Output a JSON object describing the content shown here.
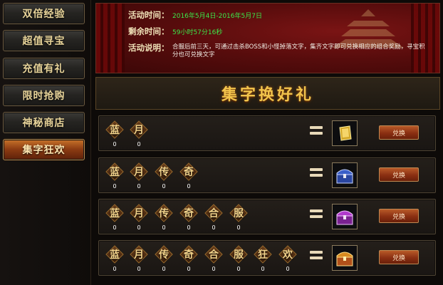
{
  "sidebar": {
    "items": [
      {
        "label": "双倍经验",
        "active": false
      },
      {
        "label": "超值寻宝",
        "active": false
      },
      {
        "label": "充值有礼",
        "active": false
      },
      {
        "label": "限时抢购",
        "active": false
      },
      {
        "label": "神秘商店",
        "active": false
      },
      {
        "label": "集字狂欢",
        "active": true
      }
    ]
  },
  "banner": {
    "time_label": "活动时间：",
    "time_value": "2016年5月4日-2016年5月7日",
    "remaining_label": "剩余时间：",
    "remaining_value": "59小时57分16秒",
    "desc_label": "活动说明：",
    "desc_value": "合服后前三天，可通过击杀BOSS和小怪掉落文字，集齐文字即可兑换相应的组合奖励，寻宝积分也可兑换文字"
  },
  "title": "集字换好礼",
  "rows": [
    {
      "chars": [
        {
          "char": "蓝",
          "count": "0"
        },
        {
          "char": "月",
          "count": "0"
        }
      ],
      "reward_icon": "gold-bar-icon",
      "button": "兑换"
    },
    {
      "chars": [
        {
          "char": "蓝",
          "count": "0"
        },
        {
          "char": "月",
          "count": "0"
        },
        {
          "char": "传",
          "count": "0"
        },
        {
          "char": "奇",
          "count": "0"
        }
      ],
      "reward_icon": "blue-chest-icon",
      "button": "兑换"
    },
    {
      "chars": [
        {
          "char": "蓝",
          "count": "0"
        },
        {
          "char": "月",
          "count": "0"
        },
        {
          "char": "传",
          "count": "0"
        },
        {
          "char": "奇",
          "count": "0"
        },
        {
          "char": "合",
          "count": "0"
        },
        {
          "char": "服",
          "count": "0"
        }
      ],
      "reward_icon": "purple-chest-icon",
      "button": "兑换"
    },
    {
      "chars": [
        {
          "char": "蓝",
          "count": "0"
        },
        {
          "char": "月",
          "count": "0"
        },
        {
          "char": "传",
          "count": "0"
        },
        {
          "char": "奇",
          "count": "0"
        },
        {
          "char": "合",
          "count": "0"
        },
        {
          "char": "服",
          "count": "0"
        },
        {
          "char": "狂",
          "count": "0"
        },
        {
          "char": "欢",
          "count": "0"
        }
      ],
      "reward_icon": "gold-chest-icon",
      "button": "兑换"
    }
  ],
  "colors": {
    "accent_gold": "#f2c44c",
    "remaining_green": "#3be84a",
    "banner_red": "#7a1414"
  }
}
